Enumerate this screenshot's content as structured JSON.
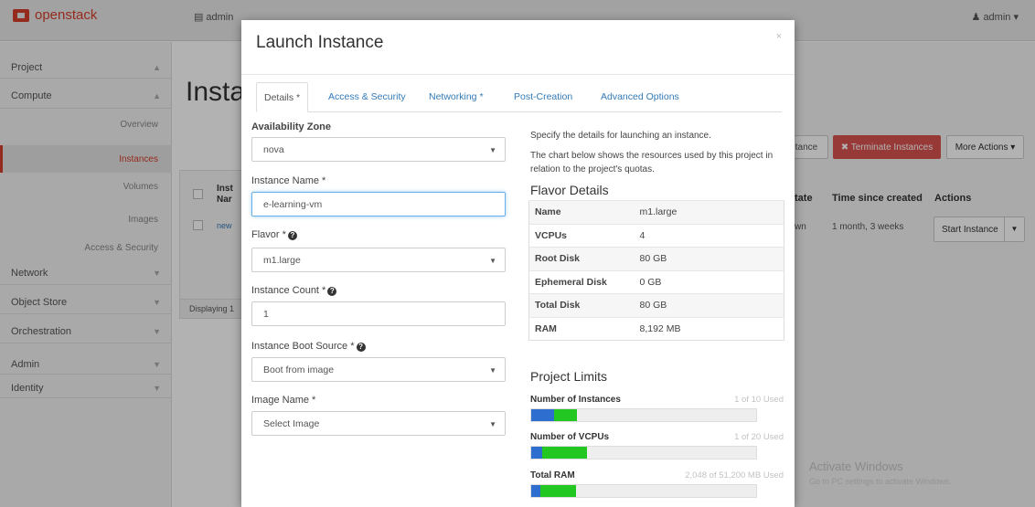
{
  "app": {
    "logo": "openstack",
    "project_menu": "admin",
    "user_menu": "admin"
  },
  "sidebar": {
    "sections": [
      "Project",
      "Compute"
    ],
    "compute_items": [
      "Overview",
      "Instances",
      "Volumes",
      "Images",
      "Access & Security"
    ],
    "groups": [
      "Network",
      "Object Store",
      "Orchestration",
      "Admin",
      "Identity"
    ]
  },
  "page": {
    "title": "Insta",
    "table_header_fragment": "Inst Nar",
    "row_fragment": "new",
    "footer_fragment": "Displaying 1",
    "buttons": {
      "launch_fragment": "tance",
      "terminate": "✖ Terminate Instances",
      "more": "More Actions ▾"
    },
    "columns": {
      "state_fragment": "tate",
      "time": "Time since created",
      "actions": "Actions"
    },
    "row": {
      "state_fragment": "wn",
      "time": "1 month, 3 weeks",
      "start": "Start Instance"
    },
    "watermark": {
      "title": "Activate Windows",
      "sub": "Go to PC settings to activate Windows."
    }
  },
  "modal": {
    "title": "Launch Instance",
    "close": "×",
    "tabs": [
      "Details *",
      "Access & Security",
      "Networking *",
      "Post-Creation",
      "Advanced Options"
    ],
    "form": {
      "availability_zone_label": "Availability Zone",
      "availability_zone_value": "nova",
      "instance_name_label": "Instance Name *",
      "instance_name_value": "e-learning-vm",
      "flavor_label": "Flavor *",
      "flavor_value": "m1.large",
      "count_label": "Instance Count *",
      "count_value": "1",
      "boot_source_label": "Instance Boot Source *",
      "boot_source_value": "Boot from image",
      "image_name_label": "Image Name *",
      "image_name_value": "Select Image"
    },
    "info": {
      "line1": "Specify the details for launching an instance.",
      "line2": "The chart below shows the resources used by this project in relation to the project's quotas.",
      "flavor_heading": "Flavor Details",
      "limits_heading": "Project Limits"
    },
    "flavor": [
      {
        "key": "Name",
        "value": "m1.large"
      },
      {
        "key": "VCPUs",
        "value": "4"
      },
      {
        "key": "Root Disk",
        "value": "80 GB"
      },
      {
        "key": "Ephemeral Disk",
        "value": "0 GB"
      },
      {
        "key": "Total Disk",
        "value": "80 GB"
      },
      {
        "key": "RAM",
        "value": "8,192 MB"
      }
    ],
    "limits": [
      {
        "label": "Number of Instances",
        "used_text": "1 of 10 Used",
        "used_fraction": 0.1,
        "added_fraction": 0.1
      },
      {
        "label": "Number of VCPUs",
        "used_text": "1 of 20 Used",
        "used_fraction": 0.05,
        "added_fraction": 0.2
      },
      {
        "label": "Total RAM",
        "used_text": "2,048 of 51,200 MB Used",
        "used_fraction": 0.04,
        "added_fraction": 0.16
      }
    ],
    "colors": {
      "used": "#2e6ecf",
      "added": "#22c722",
      "accent": "#d63d2b"
    }
  }
}
